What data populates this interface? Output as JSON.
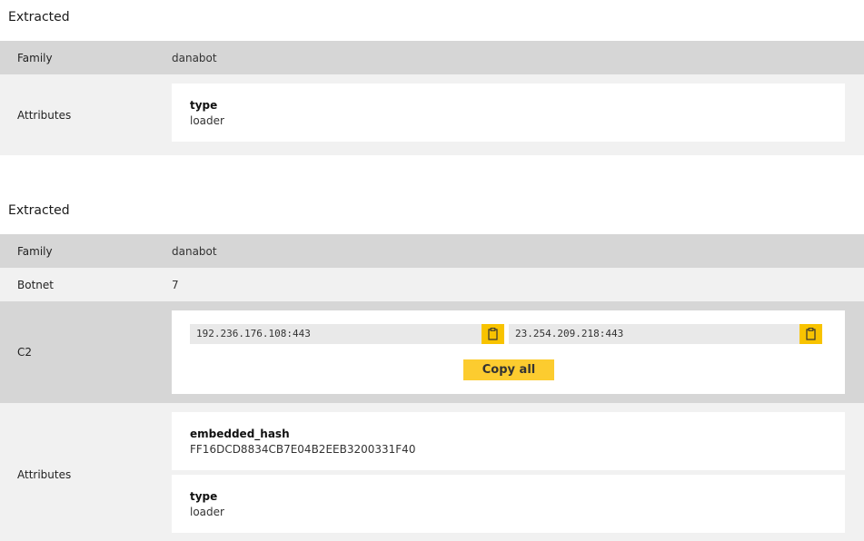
{
  "sections": [
    {
      "heading": "Extracted",
      "family": {
        "label": "Family",
        "value": "danabot"
      },
      "attributes": {
        "label": "Attributes",
        "items": [
          {
            "key": "type",
            "value": "loader"
          }
        ]
      }
    },
    {
      "heading": "Extracted",
      "family": {
        "label": "Family",
        "value": "danabot"
      },
      "botnet": {
        "label": "Botnet",
        "value": "7"
      },
      "c2": {
        "label": "C2",
        "addresses": [
          "192.236.176.108:443",
          "23.254.209.218:443"
        ],
        "copy_icon": "clipboard-icon",
        "copy_all_label": "Copy all"
      },
      "attributes": {
        "label": "Attributes",
        "items": [
          {
            "key": "embedded_hash",
            "value": "FF16DCD8834CB7E04B2EEB3200331F40"
          },
          {
            "key": "type",
            "value": "loader"
          }
        ]
      }
    }
  ],
  "colors": {
    "row_dark": "#d6d6d6",
    "row_light": "#f1f1f1",
    "accent": "#f8c300",
    "copy_all_bg": "#fccc2f"
  }
}
